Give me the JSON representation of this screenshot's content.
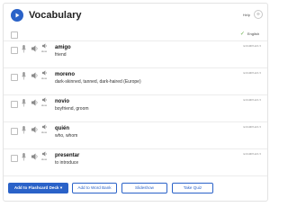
{
  "header": {
    "title": "Vocabulary",
    "help_label": "Help",
    "add_symbol": "+"
  },
  "list_header": {
    "language_label": "English"
  },
  "entries": [
    {
      "word": "amigo",
      "gloss": "friend",
      "examples_label": "EXAMPLES",
      "speed_label": "slow"
    },
    {
      "word": "moreno",
      "gloss": "dark-skinned, tanned, dark-haired (Europe)",
      "examples_label": "EXAMPLES",
      "speed_label": "slow"
    },
    {
      "word": "novio",
      "gloss": "boyfriend, groom",
      "examples_label": "EXAMPLES",
      "speed_label": "slow"
    },
    {
      "word": "quién",
      "gloss": "who, whom",
      "examples_label": "EXAMPLES",
      "speed_label": "slow"
    },
    {
      "word": "presentar",
      "gloss": "to introduce",
      "examples_label": "EXAMPLES",
      "speed_label": "slow"
    }
  ],
  "actions": {
    "flashcard_label": "Add to Flashcard Deck",
    "flashcard_caret": "▾",
    "wordbank_label": "Add to Word Bank",
    "slideshow_label": "Slideshow",
    "quiz_label": "Take Quiz"
  },
  "colors": {
    "accent": "#2a62c8",
    "check": "#68b04a"
  }
}
